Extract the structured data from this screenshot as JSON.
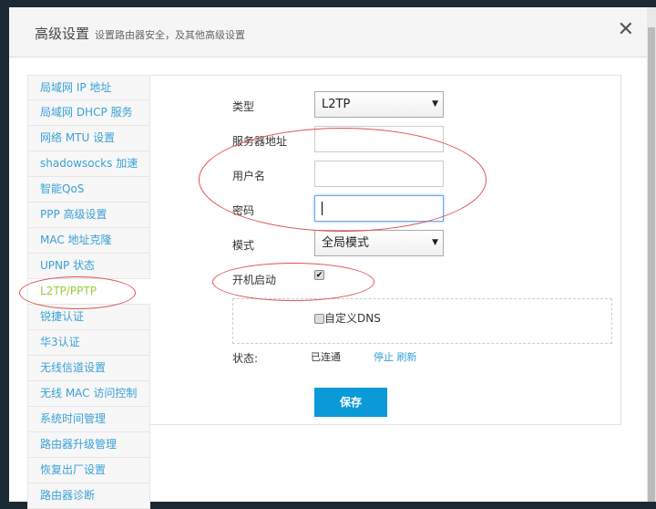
{
  "header": {
    "title": "高级设置",
    "subtitle": "设置路由器安全，及其他高级设置",
    "close_icon": "close-icon"
  },
  "sidebar": {
    "items": [
      "局域网 IP 地址",
      "局域网 DHCP 服务",
      "网络 MTU 设置",
      "shadowsocks 加速",
      "智能QoS",
      "PPP 高级设置",
      "MAC 地址克隆",
      "UPNP 状态",
      "L2TP/PPTP",
      "锐捷认证",
      "华3认证",
      "无线信道设置",
      "无线 MAC 访问控制",
      "系统时间管理",
      "路由器升级管理",
      "恢复出厂设置",
      "路由器诊断"
    ],
    "active_index": 8
  },
  "form": {
    "type_label": "类型",
    "type_value": "L2TP",
    "server_label": "服务器地址",
    "server_value": "",
    "user_label": "用户名",
    "user_value": "",
    "password_label": "密码",
    "password_value": "",
    "mode_label": "模式",
    "mode_value": "全局模式",
    "autostart_label": "开机启动",
    "autostart_checked": true,
    "dns_label": "自定义DNS",
    "dns_checked": false,
    "status_label": "状态:",
    "status_value": "已连通",
    "stop_link": "停止",
    "refresh_link": "刷新",
    "save_label": "保存"
  },
  "colors": {
    "accent": "#0a9ad8",
    "link": "#3aa0d8",
    "active": "#9ccc3c",
    "annotation": "#e05050"
  }
}
